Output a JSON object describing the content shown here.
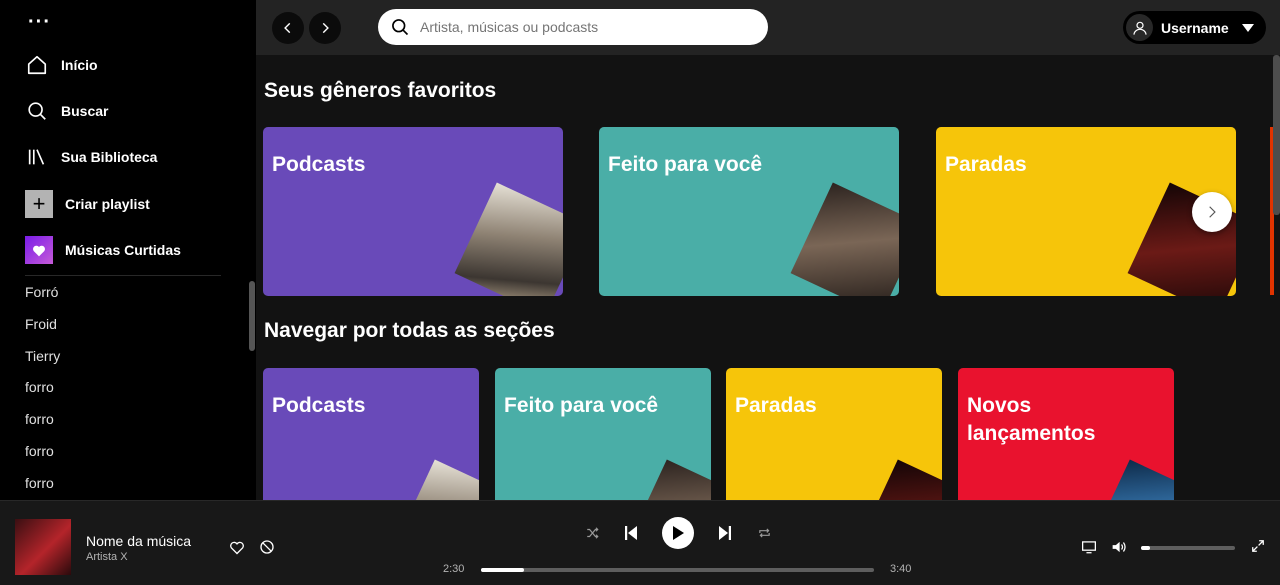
{
  "sidebar": {
    "menu_icon": "more-dots-icon",
    "nav": [
      {
        "label": "Início",
        "icon": "home-icon"
      },
      {
        "label": "Buscar",
        "icon": "search-icon"
      },
      {
        "label": "Sua Biblioteca",
        "icon": "library-icon"
      }
    ],
    "create_playlist": "Criar playlist",
    "liked_songs": "Músicas Curtidas",
    "playlists": [
      "Forró",
      "Froid",
      "Tierry",
      "forro",
      "forro",
      "forro",
      "forro"
    ]
  },
  "topbar": {
    "search_placeholder": "Artista, músicas ou podcasts",
    "username": "Username"
  },
  "main": {
    "favorites_title": "Seus gêneros favoritos",
    "favorites": [
      {
        "label": "Podcasts",
        "color": "#694ab9"
      },
      {
        "label": "Feito para você",
        "color": "#4aaea7"
      },
      {
        "label": "Paradas",
        "color": "#f6c50a"
      }
    ],
    "browse_title": "Navegar por todas as seções",
    "browse": [
      {
        "label": "Podcasts",
        "color": "#694ab9"
      },
      {
        "label": "Feito para você",
        "color": "#4aaea7"
      },
      {
        "label": "Paradas",
        "color": "#f6c50a"
      },
      {
        "label": "Novos lançamentos",
        "color": "#e9122e"
      }
    ]
  },
  "player": {
    "track_name": "Nome da música",
    "artist": "Artista X",
    "elapsed": "2:30",
    "duration": "3:40",
    "progress_fraction": 0.11,
    "volume_fraction": 0.1
  }
}
